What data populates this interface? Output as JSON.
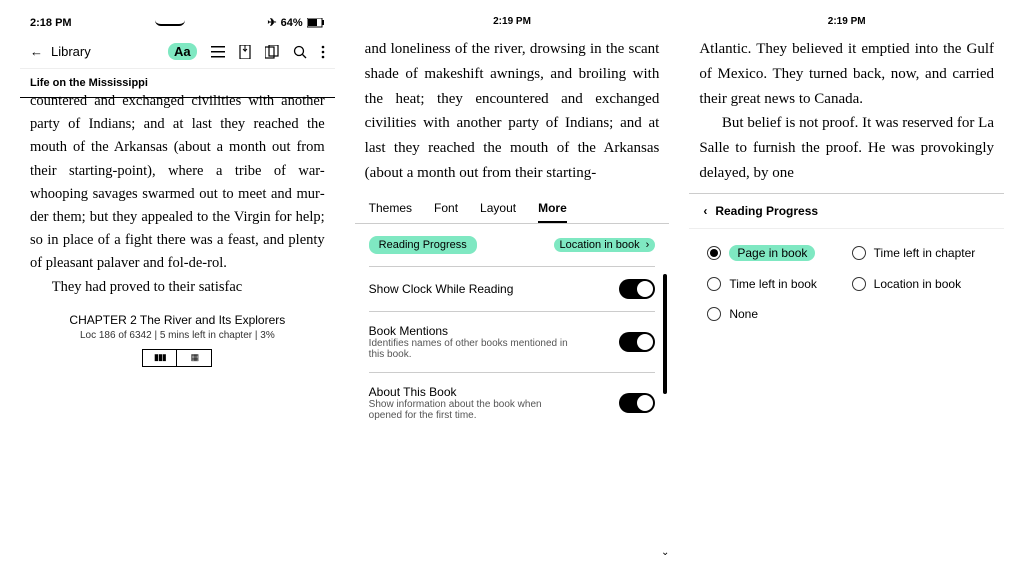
{
  "panel1": {
    "status": {
      "time": "2:18 PM",
      "battery": "64%"
    },
    "library_label": "Library",
    "aa_label": "Aa",
    "book_title": "Life on the Mississippi",
    "body_para1": "countered and exchanged civilities with another party of Indians; and at last they reached the mouth of the Arkansas (about a month out from their starting-point), where a tribe of war-whooping savages swarmed out to meet and mur­der them; but they appealed to the Vir­gin for help; so in place of a fight there was a feast, and plenty of pleasant pa­laver and fol-de-rol.",
    "body_para2": "They had proved to their satisfac­",
    "footer_chapter": "CHAPTER 2 The River and Its Explorers",
    "footer_loc": "Loc 186 of 6342 | 5 mins left in chapter | 3%"
  },
  "panel2": {
    "time": "2:19 PM",
    "body": "and loneliness of the river, drowsing in the scant shade of makeshift awnings, and broiling with the heat; they en­countered and exchanged civilities with another party of Indians; and at last they reached the mouth of the Arkansas (about a month out from their starting-",
    "tabs": {
      "themes": "Themes",
      "font": "Font",
      "layout": "Layout",
      "more": "More"
    },
    "reading_progress": "Reading Progress",
    "location_in_book": "Location in book",
    "settings": {
      "clock": {
        "label": "Show Clock While Reading"
      },
      "mentions": {
        "label": "Book Mentions",
        "sub": "Identifies names of other books mentioned in this book."
      },
      "about": {
        "label": "About This Book",
        "sub": "Show information about the book when opened for the first time."
      }
    }
  },
  "panel3": {
    "time": "2:19 PM",
    "body_p1": "Atlantic. They believed it emptied into the Gulf of Mexico. They turned back, now, and carried their great news to Canada.",
    "body_p2": "But belief is not proof. It was re­served for La Salle to furnish the proof. He was provokingly delayed, by one",
    "header": "Reading Progress",
    "options": {
      "page": "Page in book",
      "time_chapter": "Time left in chapter",
      "time_book": "Time left in book",
      "location": "Location in book",
      "none": "None"
    }
  }
}
